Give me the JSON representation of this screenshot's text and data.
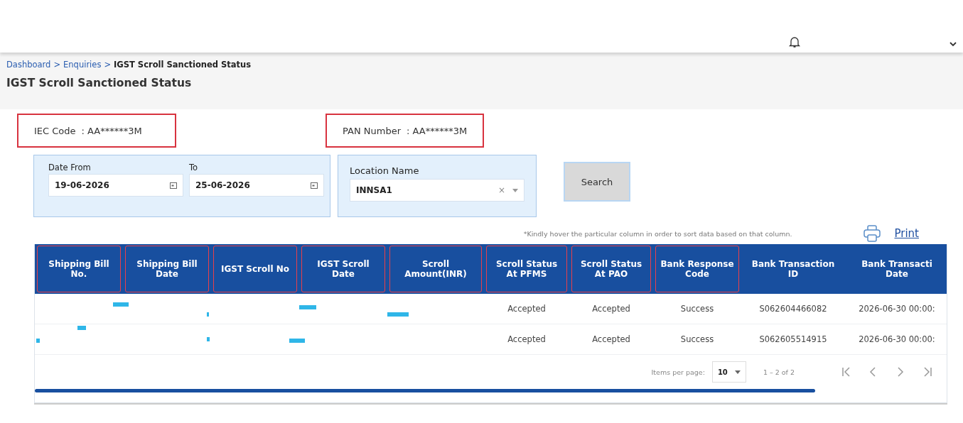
{
  "breadcrumb": [
    {
      "label": "Dashboard",
      "link": true
    },
    {
      "separator": ">",
      "label": "Enquiries",
      "link": true
    },
    {
      "separator": ">",
      "label": "IGST Scroll Sanctioned Status",
      "link": false
    }
  ],
  "page_title": "IGST Scroll Sanctioned Status",
  "info": [
    {
      "label": "IEC Code",
      "value": ": AA******3M",
      "highlighted": true
    },
    {
      "label": "PAN Number",
      "value": ": AA******3M",
      "highlighted": true
    }
  ],
  "filters": {
    "date_from": {
      "label": "Date From",
      "value": "19-06-2026"
    },
    "date_to": {
      "label": "To",
      "value": "25-06-2026"
    },
    "location": {
      "label": "Location Name",
      "value": "INNSA1",
      "clear": "×"
    },
    "search_button": "Search"
  },
  "note": "*Kindly hover the particular column in order to sort data based on that column.",
  "print_link": "Print",
  "table": {
    "columns": [
      {
        "label": "Shipping Bill No.",
        "highlighted": true
      },
      {
        "label": "Shipping Bill Date",
        "highlighted": true
      },
      {
        "label": "IGST Scroll No",
        "highlighted": true
      },
      {
        "label": "IGST Scroll Date",
        "highlighted": true
      },
      {
        "label": "Scroll Amount(INR)",
        "highlighted": true
      },
      {
        "label": "Scroll Status At PFMS",
        "highlighted": true
      },
      {
        "label": "Scroll Status At PAO",
        "highlighted": true
      },
      {
        "label": "Bank Response Code",
        "highlighted": true
      },
      {
        "label": "Bank Transaction ID",
        "highlighted": false
      },
      {
        "label": "Bank Transacti Date",
        "highlighted": false
      }
    ],
    "rows": [
      {
        "scroll_status_pfms": "Accepted",
        "scroll_status_pao": "Accepted",
        "bank_response_code": "Success",
        "bank_transaction_id": "S062604466082",
        "bank_transaction_date": "2026-06-30 00:00:"
      },
      {
        "scroll_status_pfms": "Accepted",
        "scroll_status_pao": "Accepted",
        "bank_response_code": "Success",
        "bank_transaction_id": "S062605514915",
        "bank_transaction_date": "2026-06-30 00:00:"
      }
    ]
  },
  "paginator": {
    "items_per_page_label": "Items per page:",
    "page_size": "10",
    "range": "1 – 2 of 2"
  }
}
